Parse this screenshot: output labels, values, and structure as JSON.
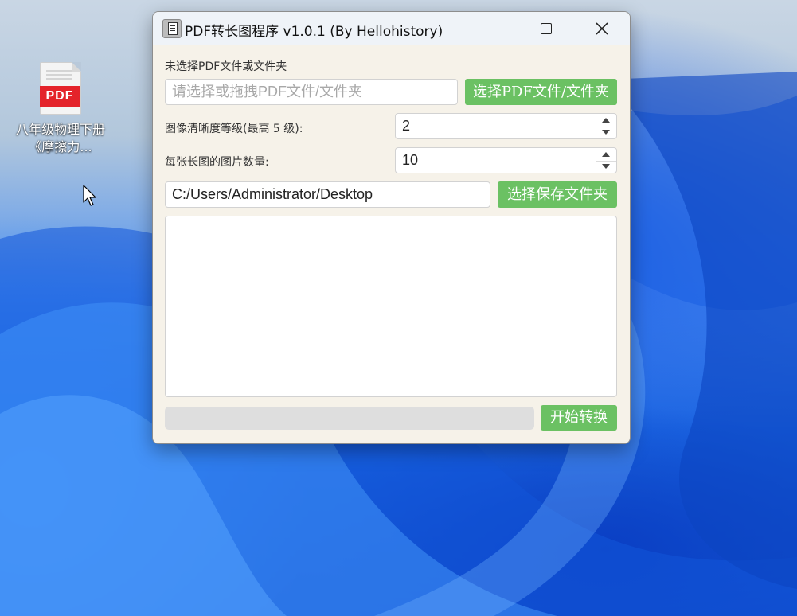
{
  "desktop": {
    "file_icon": {
      "badge": "PDF",
      "label": "八年级物理下册《摩擦力..."
    }
  },
  "window": {
    "title": "PDF转长图程序 v1.0.1 (By Hellohistory)",
    "controls": {
      "minimize": "minimize-icon",
      "maximize": "maximize-icon",
      "close": "close-icon"
    }
  },
  "form": {
    "status_text": "未选择PDF文件或文件夹",
    "pdf_input": {
      "value": "",
      "placeholder": "请选择或拖拽PDF文件/文件夹"
    },
    "select_pdf_button": "选择PDF文件/文件夹",
    "clarity_label": "图像清晰度等级(最高 5 级):",
    "clarity_value": "2",
    "images_per_label": "每张长图的图片数量:",
    "images_per_value": "10",
    "save_path": "C:/Users/Administrator/Desktop",
    "select_save_button": "选择保存文件夹",
    "start_button": "开始转换",
    "progress": 0
  },
  "colors": {
    "accent": "#6bc163",
    "window_bg": "#f6f2e9",
    "titlebar_bg": "#eff3f8"
  }
}
